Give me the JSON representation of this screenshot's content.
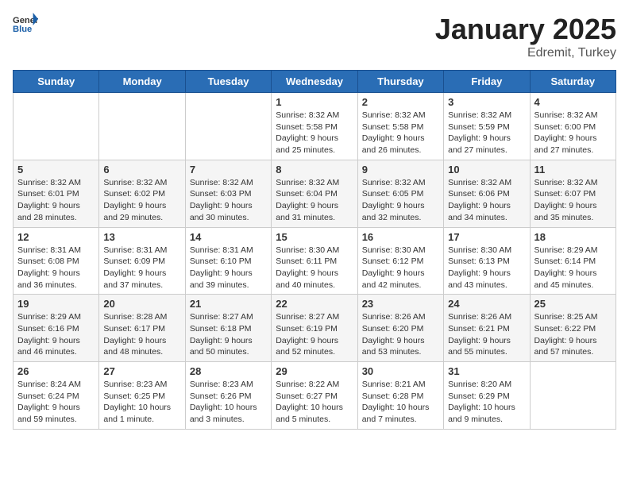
{
  "header": {
    "logo_general": "General",
    "logo_blue": "Blue",
    "title": "January 2025",
    "subtitle": "Edremit, Turkey"
  },
  "weekdays": [
    "Sunday",
    "Monday",
    "Tuesday",
    "Wednesday",
    "Thursday",
    "Friday",
    "Saturday"
  ],
  "weeks": [
    [
      {
        "day": null,
        "info": null
      },
      {
        "day": null,
        "info": null
      },
      {
        "day": null,
        "info": null
      },
      {
        "day": "1",
        "info": "Sunrise: 8:32 AM\nSunset: 5:58 PM\nDaylight: 9 hours and 25 minutes."
      },
      {
        "day": "2",
        "info": "Sunrise: 8:32 AM\nSunset: 5:58 PM\nDaylight: 9 hours and 26 minutes."
      },
      {
        "day": "3",
        "info": "Sunrise: 8:32 AM\nSunset: 5:59 PM\nDaylight: 9 hours and 27 minutes."
      },
      {
        "day": "4",
        "info": "Sunrise: 8:32 AM\nSunset: 6:00 PM\nDaylight: 9 hours and 27 minutes."
      }
    ],
    [
      {
        "day": "5",
        "info": "Sunrise: 8:32 AM\nSunset: 6:01 PM\nDaylight: 9 hours and 28 minutes."
      },
      {
        "day": "6",
        "info": "Sunrise: 8:32 AM\nSunset: 6:02 PM\nDaylight: 9 hours and 29 minutes."
      },
      {
        "day": "7",
        "info": "Sunrise: 8:32 AM\nSunset: 6:03 PM\nDaylight: 9 hours and 30 minutes."
      },
      {
        "day": "8",
        "info": "Sunrise: 8:32 AM\nSunset: 6:04 PM\nDaylight: 9 hours and 31 minutes."
      },
      {
        "day": "9",
        "info": "Sunrise: 8:32 AM\nSunset: 6:05 PM\nDaylight: 9 hours and 32 minutes."
      },
      {
        "day": "10",
        "info": "Sunrise: 8:32 AM\nSunset: 6:06 PM\nDaylight: 9 hours and 34 minutes."
      },
      {
        "day": "11",
        "info": "Sunrise: 8:32 AM\nSunset: 6:07 PM\nDaylight: 9 hours and 35 minutes."
      }
    ],
    [
      {
        "day": "12",
        "info": "Sunrise: 8:31 AM\nSunset: 6:08 PM\nDaylight: 9 hours and 36 minutes."
      },
      {
        "day": "13",
        "info": "Sunrise: 8:31 AM\nSunset: 6:09 PM\nDaylight: 9 hours and 37 minutes."
      },
      {
        "day": "14",
        "info": "Sunrise: 8:31 AM\nSunset: 6:10 PM\nDaylight: 9 hours and 39 minutes."
      },
      {
        "day": "15",
        "info": "Sunrise: 8:30 AM\nSunset: 6:11 PM\nDaylight: 9 hours and 40 minutes."
      },
      {
        "day": "16",
        "info": "Sunrise: 8:30 AM\nSunset: 6:12 PM\nDaylight: 9 hours and 42 minutes."
      },
      {
        "day": "17",
        "info": "Sunrise: 8:30 AM\nSunset: 6:13 PM\nDaylight: 9 hours and 43 minutes."
      },
      {
        "day": "18",
        "info": "Sunrise: 8:29 AM\nSunset: 6:14 PM\nDaylight: 9 hours and 45 minutes."
      }
    ],
    [
      {
        "day": "19",
        "info": "Sunrise: 8:29 AM\nSunset: 6:16 PM\nDaylight: 9 hours and 46 minutes."
      },
      {
        "day": "20",
        "info": "Sunrise: 8:28 AM\nSunset: 6:17 PM\nDaylight: 9 hours and 48 minutes."
      },
      {
        "day": "21",
        "info": "Sunrise: 8:27 AM\nSunset: 6:18 PM\nDaylight: 9 hours and 50 minutes."
      },
      {
        "day": "22",
        "info": "Sunrise: 8:27 AM\nSunset: 6:19 PM\nDaylight: 9 hours and 52 minutes."
      },
      {
        "day": "23",
        "info": "Sunrise: 8:26 AM\nSunset: 6:20 PM\nDaylight: 9 hours and 53 minutes."
      },
      {
        "day": "24",
        "info": "Sunrise: 8:26 AM\nSunset: 6:21 PM\nDaylight: 9 hours and 55 minutes."
      },
      {
        "day": "25",
        "info": "Sunrise: 8:25 AM\nSunset: 6:22 PM\nDaylight: 9 hours and 57 minutes."
      }
    ],
    [
      {
        "day": "26",
        "info": "Sunrise: 8:24 AM\nSunset: 6:24 PM\nDaylight: 9 hours and 59 minutes."
      },
      {
        "day": "27",
        "info": "Sunrise: 8:23 AM\nSunset: 6:25 PM\nDaylight: 10 hours and 1 minute."
      },
      {
        "day": "28",
        "info": "Sunrise: 8:23 AM\nSunset: 6:26 PM\nDaylight: 10 hours and 3 minutes."
      },
      {
        "day": "29",
        "info": "Sunrise: 8:22 AM\nSunset: 6:27 PM\nDaylight: 10 hours and 5 minutes."
      },
      {
        "day": "30",
        "info": "Sunrise: 8:21 AM\nSunset: 6:28 PM\nDaylight: 10 hours and 7 minutes."
      },
      {
        "day": "31",
        "info": "Sunrise: 8:20 AM\nSunset: 6:29 PM\nDaylight: 10 hours and 9 minutes."
      },
      {
        "day": null,
        "info": null
      }
    ]
  ]
}
